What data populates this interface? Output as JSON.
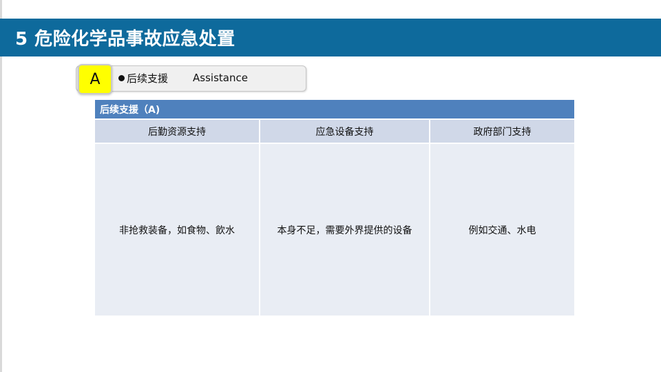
{
  "slide": {
    "title": "5 危险化学品事故应急处置"
  },
  "section_label": {
    "badge": "A",
    "label_cn": "后续支援",
    "label_en": "Assistance"
  },
  "table": {
    "header": "后续支援（A)",
    "columns": [
      "后勤资源支持",
      "应急设备支持",
      "政府部门支持"
    ],
    "rows": [
      [
        "非抢救装备，如食物、飲水",
        "本身不足，需要外界提供的设备",
        "例如交通、水电"
      ]
    ]
  }
}
